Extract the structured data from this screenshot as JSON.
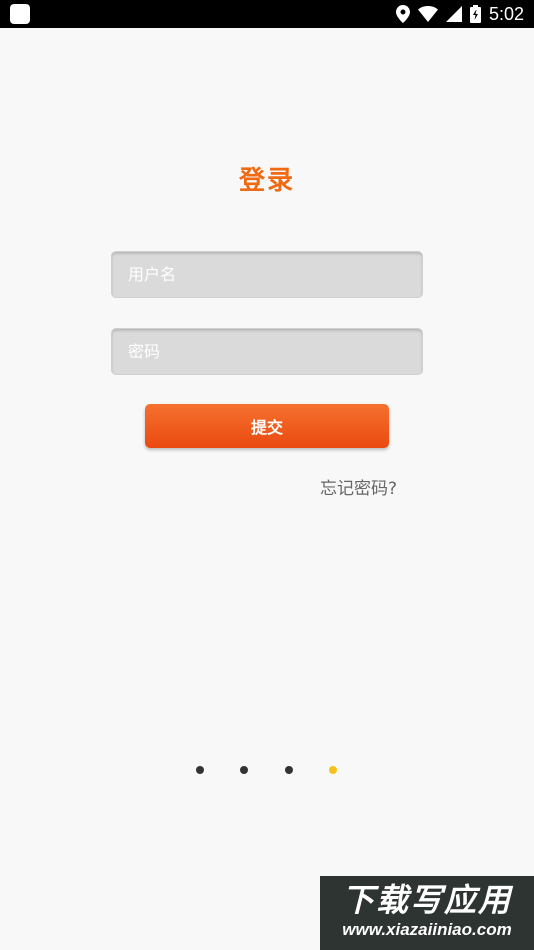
{
  "status_bar": {
    "time": "5:02",
    "icons": [
      "app-notification-icon",
      "location-icon",
      "wifi-icon",
      "signal-icon",
      "battery-icon"
    ]
  },
  "login": {
    "title": "登录",
    "username_placeholder": "用户名",
    "password_placeholder": "密码",
    "submit_label": "提交",
    "forgot_label": "忘记密码?"
  },
  "pager": {
    "count": 4,
    "active_index": 3,
    "colors": {
      "inactive": "#333333",
      "active": "#f5c21b"
    }
  },
  "watermark": {
    "main": "下载写应用",
    "url": "www.xiazaiiniao.com"
  },
  "colors": {
    "accent": "#f06a14",
    "button": "#ea4a0f",
    "background": "#f8f8f8"
  }
}
